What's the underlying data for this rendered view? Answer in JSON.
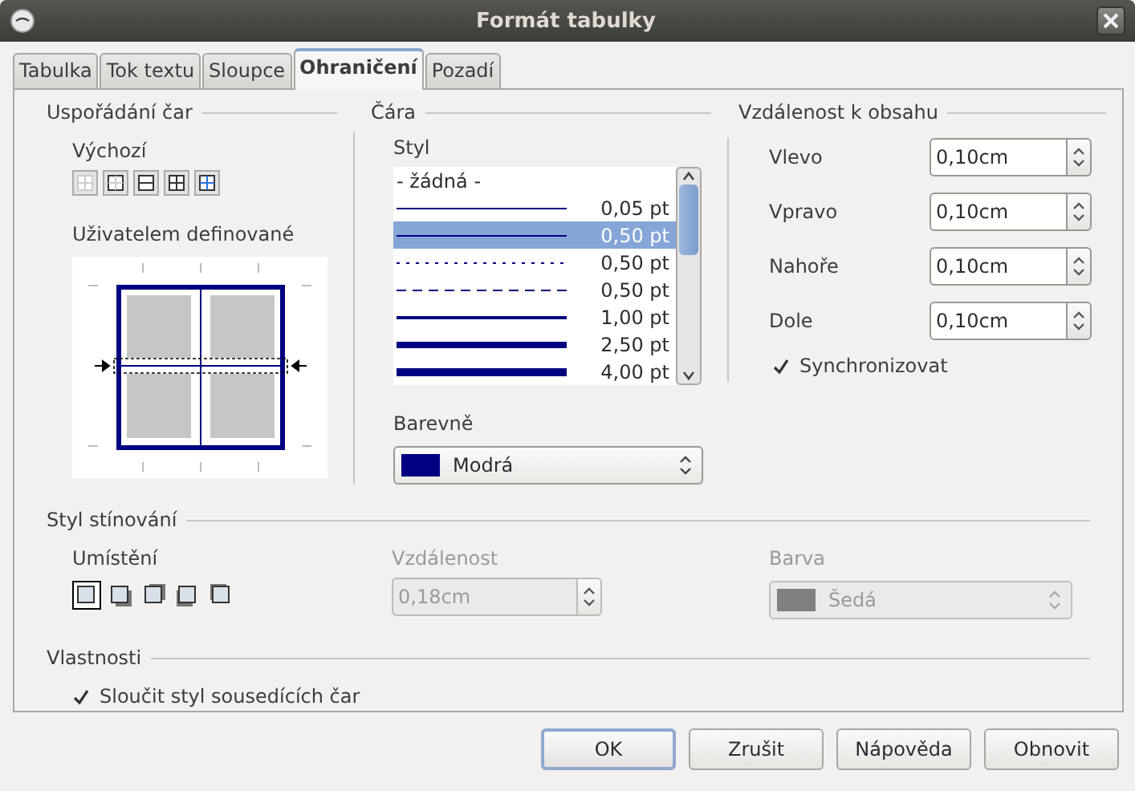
{
  "window": {
    "title": "Formát tabulky"
  },
  "tabs": [
    {
      "label": "Tabulka",
      "selected": false
    },
    {
      "label": "Tok textu",
      "selected": false
    },
    {
      "label": "Sloupce",
      "selected": false
    },
    {
      "label": "Ohraničení",
      "selected": true
    },
    {
      "label": "Pozadí",
      "selected": false
    }
  ],
  "line_arrangement": {
    "title": "Uspořádání čar",
    "default_label": "Výchozí",
    "user_defined_label": "Uživatelem definované"
  },
  "line": {
    "title": "Čára",
    "style_label": "Styl",
    "styles": [
      {
        "kind": "none",
        "label": "- žádná -",
        "selected": false
      },
      {
        "kind": "hairline",
        "label": "0,05 pt",
        "selected": false
      },
      {
        "kind": "thin",
        "label": "0,50 pt",
        "selected": true
      },
      {
        "kind": "dotted",
        "label": "0,50 pt",
        "selected": false
      },
      {
        "kind": "dashed",
        "label": "0,50 pt",
        "selected": false
      },
      {
        "kind": "medium",
        "label": "1,00 pt",
        "selected": false
      },
      {
        "kind": "thick",
        "label": "2,50 pt",
        "selected": false
      },
      {
        "kind": "extra-thick",
        "label": "4,00 pt",
        "selected": false
      }
    ],
    "color_label": "Barevně",
    "color": {
      "value": "Modrá",
      "color": "#000080"
    }
  },
  "spacing": {
    "title": "Vzdálenost k obsahu",
    "fields": [
      {
        "label": "Vlevo",
        "value": "0,10cm"
      },
      {
        "label": "Vpravo",
        "value": "0,10cm"
      },
      {
        "label": "Nahoře",
        "value": "0,10cm"
      },
      {
        "label": "Dole",
        "value": "0,10cm"
      }
    ],
    "sync": {
      "label": "Synchronizovat",
      "checked": true
    }
  },
  "shadow": {
    "title": "Styl stínování",
    "position_label": "Umístění",
    "positions": [
      {
        "kind": "none",
        "selected": true
      },
      {
        "kind": "bottom-right",
        "selected": false
      },
      {
        "kind": "top-right",
        "selected": false
      },
      {
        "kind": "bottom-left",
        "selected": false
      },
      {
        "kind": "top-left",
        "selected": false
      }
    ],
    "distance_label": "Vzdálenost",
    "distance": {
      "value": "0,18cm",
      "disabled": true
    },
    "color_label": "Barva",
    "color": {
      "value": "Šedá",
      "color": "#808080",
      "disabled": true
    }
  },
  "properties": {
    "title": "Vlastnosti",
    "merge": {
      "label": "Sloučit styl sousedících čar",
      "checked": true
    }
  },
  "buttons": [
    {
      "label": "OK",
      "default": true
    },
    {
      "label": "Zrušit",
      "default": false
    },
    {
      "label": "Nápověda",
      "default": false
    },
    {
      "label": "Obnovit",
      "default": false
    }
  ]
}
